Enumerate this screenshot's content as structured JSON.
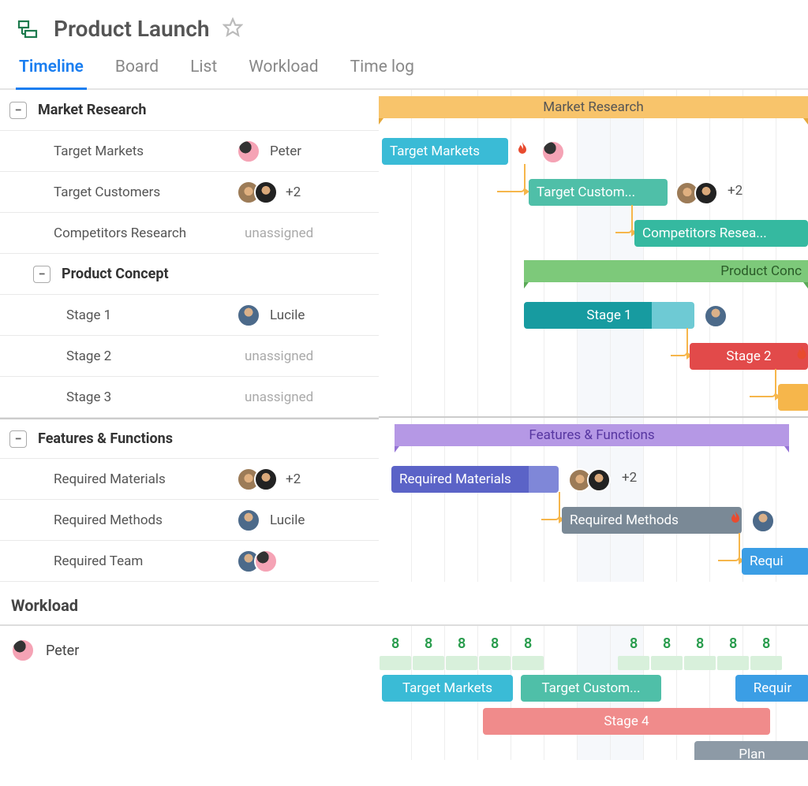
{
  "header": {
    "title": "Product Launch"
  },
  "tabs": [
    {
      "label": "Timeline",
      "active": true
    },
    {
      "label": "Board",
      "active": false
    },
    {
      "label": "List",
      "active": false
    },
    {
      "label": "Workload",
      "active": false
    },
    {
      "label": "Time log",
      "active": false
    }
  ],
  "groups": {
    "marketResearch": {
      "label": "Market Research"
    },
    "productConcept": {
      "label": "Product Concept"
    },
    "featuresFunctions": {
      "label": "Features & Functions"
    }
  },
  "tasks": {
    "targetMarkets": {
      "name": "Target Markets",
      "assignee": "Peter",
      "barLabel": "Target Markets"
    },
    "targetCustomers": {
      "name": "Target Customers",
      "more": "+2",
      "barLabel": "Target Custom..."
    },
    "competitorsResearch": {
      "name": "Competitors Research",
      "assignee": "unassigned",
      "barLabel": "Competitors Resea..."
    },
    "stage1": {
      "name": "Stage 1",
      "assignee": "Lucile",
      "barLabel": "Stage 1"
    },
    "stage2": {
      "name": "Stage 2",
      "assignee": "unassigned",
      "barLabel": "Stage 2"
    },
    "stage3": {
      "name": "Stage 3",
      "assignee": "unassigned"
    },
    "requiredMaterials": {
      "name": "Required Materials",
      "more": "+2",
      "barLabel": "Required Materials"
    },
    "requiredMethods": {
      "name": "Required Methods",
      "assignee": "Lucile",
      "barLabel": "Required Methods"
    },
    "requiredTeam": {
      "name": "Required Team",
      "barLabel": "Requi"
    }
  },
  "ganttGroupBars": {
    "marketResearch": "Market Research",
    "productConcept": "Product Conc",
    "featuresFunctions": "Features & Functions"
  },
  "trailing": {
    "targetCustomersMore": "+2",
    "requiredMaterialsMore": "+2"
  },
  "workload": {
    "heading": "Workload",
    "person": "Peter",
    "hours": [
      "8",
      "8",
      "8",
      "8",
      "8",
      "8",
      "8",
      "8",
      "8",
      "8"
    ],
    "bars": {
      "targetMarkets": "Target Markets",
      "targetCustomers": "Target Custom...",
      "required": "Requir",
      "stage4": "Stage 4",
      "plan": "Plan"
    }
  }
}
